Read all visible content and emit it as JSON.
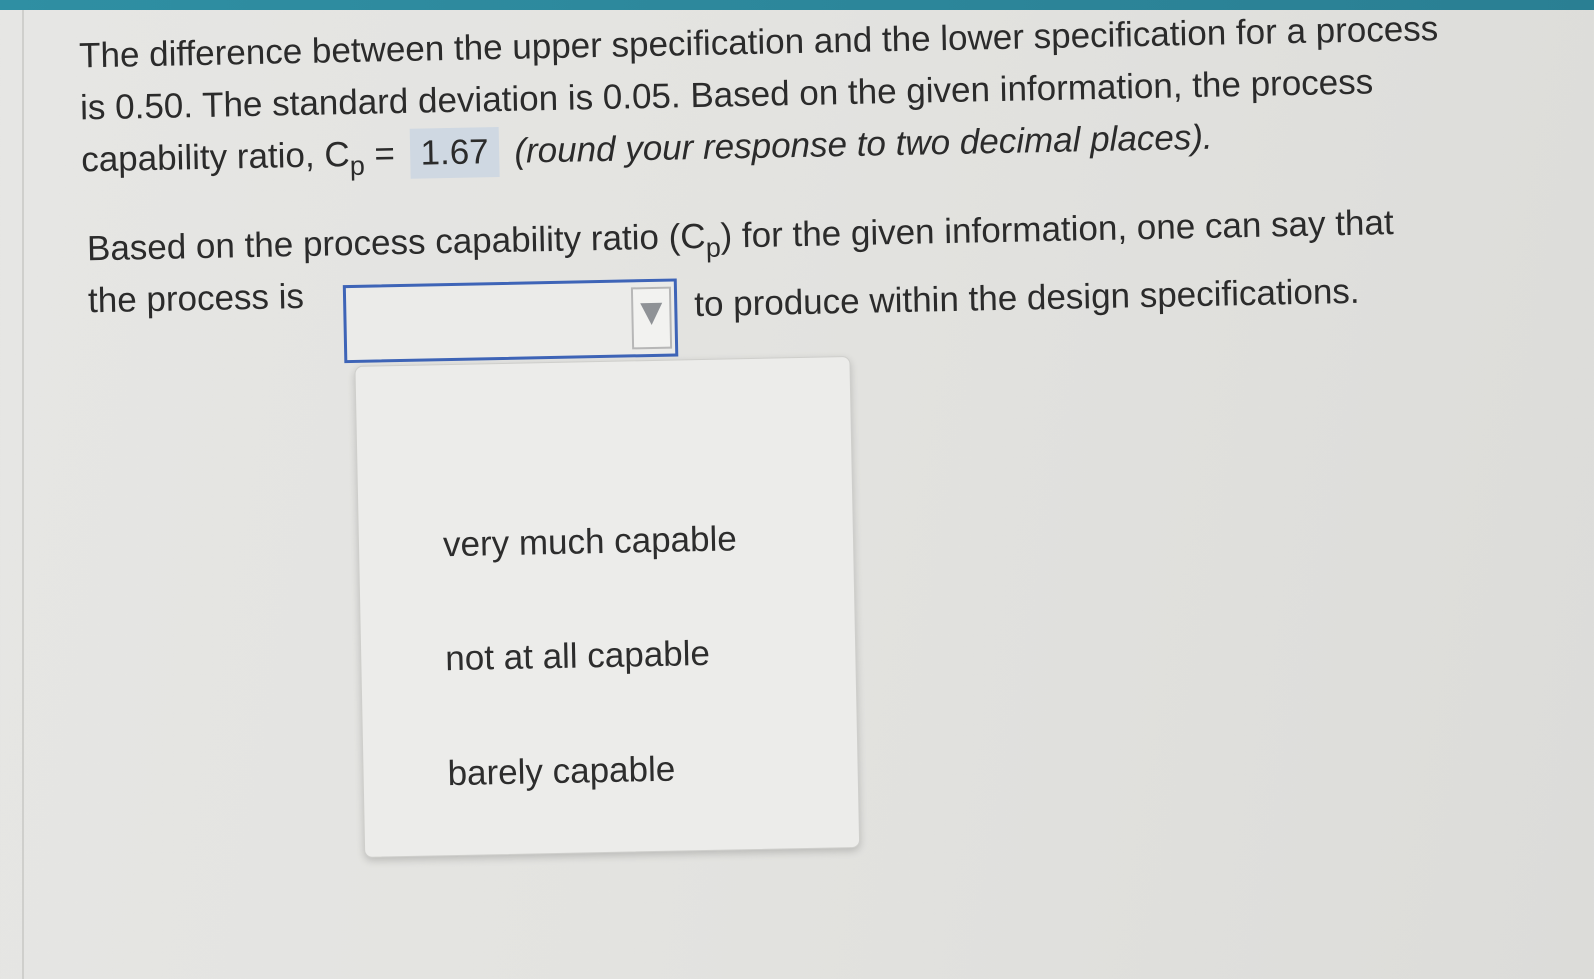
{
  "question": {
    "line1": "The difference between the upper specification and the lower specification for a process",
    "line2": "is 0.50.  The standard deviation is 0.05.  Based on the given information, the process",
    "line3_prefix": "capability ratio, C",
    "line3_subscript": "p",
    "line3_equals": " = ",
    "answer_value": "1.67",
    "line3_suffix": "(round your response to two decimal places)."
  },
  "followup": {
    "line1_prefix": "Based on the process capability ratio (C",
    "line1_subscript": "p",
    "line1_suffix": ") for the given information, one can say that",
    "line2_prefix": "the process is",
    "line2_suffix": "to produce within the design specifications."
  },
  "dropdown": {
    "selected_value": "",
    "icon": "triangle-down-icon",
    "options": [
      "very much capable",
      "not at all capable",
      "barely capable"
    ]
  },
  "colors": {
    "accent_border": "#3e64b7",
    "answer_highlight": "#cfd8e2",
    "top_strip": "#2f8fa3"
  }
}
